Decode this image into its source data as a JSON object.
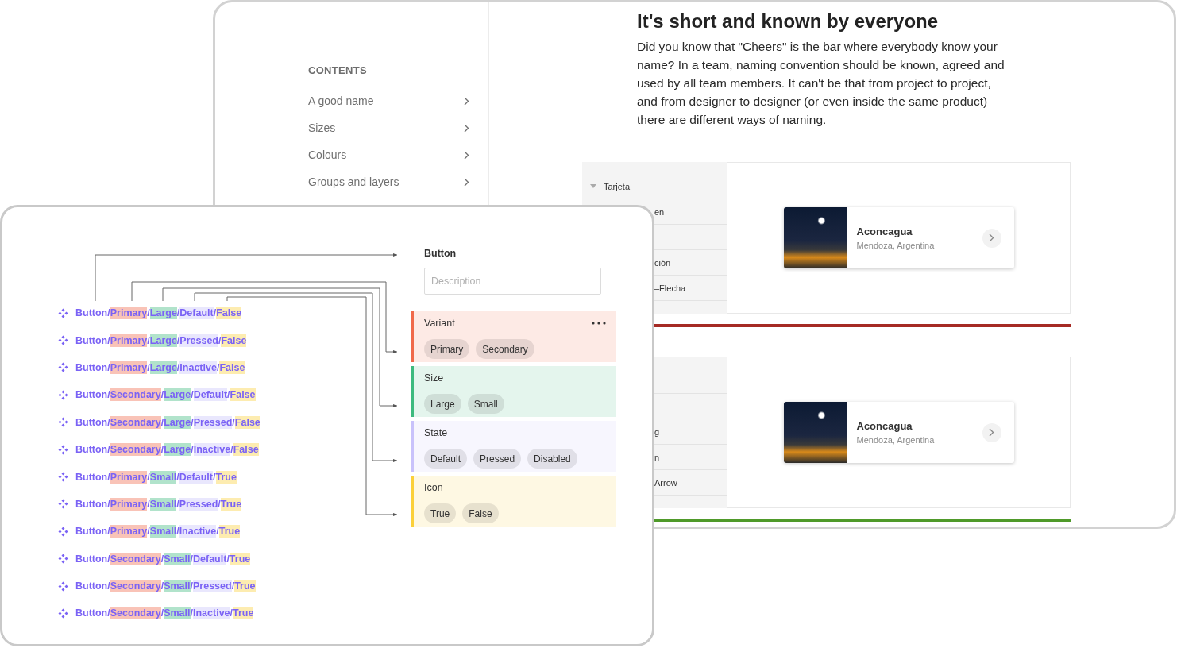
{
  "back_window": {
    "sidebar": {
      "heading": "CONTENTS",
      "items": [
        {
          "label": "A good name"
        },
        {
          "label": "Sizes"
        },
        {
          "label": "Colours"
        },
        {
          "label": "Groups and layers"
        }
      ]
    },
    "article": {
      "title": "It's short and known by everyone",
      "paragraph": "Did you know that \"Cheers\" is the bar where everybody know your name? In a team, naming convention should be known, agreed and used by all team members. It can't be that from project to project, and from designer to designer (or even inside the same product) there are different ways of naming."
    },
    "previews": [
      {
        "color": "#a52a24",
        "layers": [
          {
            "kind": "named",
            "label": "Tarjeta",
            "expanded": true
          },
          {
            "kind": "named",
            "label": "en"
          },
          {
            "kind": "covered"
          },
          {
            "kind": "named",
            "label": "ción"
          },
          {
            "kind": "named",
            "label": "–Flecha"
          }
        ],
        "card": {
          "title": "Aconcagua",
          "subtitle": "Mendoza, Argentina"
        }
      },
      {
        "color": "#4f9a2a",
        "layers": [
          {
            "kind": "covered"
          },
          {
            "kind": "covered"
          },
          {
            "kind": "named",
            "label": "g"
          },
          {
            "kind": "named",
            "label": "n"
          },
          {
            "kind": "named",
            "label": "Arrow"
          }
        ],
        "card": {
          "title": "Aconcagua",
          "subtitle": "Mendoza, Argentina"
        }
      }
    ]
  },
  "front_window": {
    "components": [
      {
        "name": "Button/Primary/Large/Default/False"
      },
      {
        "name": "Button/Primary/Large/Pressed/False"
      },
      {
        "name": "Button/Primary/Large/Inactive/False"
      },
      {
        "name": "Button/Secondary/Large/Default/False"
      },
      {
        "name": "Button/Secondary/Large/Pressed/False"
      },
      {
        "name": "Button/Secondary/Large/Inactive/False"
      },
      {
        "name": "Button/Primary/Small/Default/True"
      },
      {
        "name": "Button/Primary/Small/Pressed/True"
      },
      {
        "name": "Button/Primary/Small/Inactive/True"
      },
      {
        "name": "Button/Secondary/Small/Default/True"
      },
      {
        "name": "Button/Secondary/Small/Pressed/True"
      },
      {
        "name": "Button/Secondary/Small/Inactive/True"
      }
    ],
    "panel": {
      "title": "Button",
      "description": {
        "placeholder": "Description"
      },
      "properties": [
        {
          "name": "Variant",
          "color": "#f0694a",
          "values": [
            "Primary",
            "Secondary"
          ]
        },
        {
          "name": "Size",
          "color": "#3dba7e",
          "values": [
            "Large",
            "Small"
          ]
        },
        {
          "name": "State",
          "color": "#c9c2fb",
          "values": [
            "Default",
            "Pressed",
            "Disabled"
          ]
        },
        {
          "name": "Icon",
          "color": "#fbd03a",
          "values": [
            "True",
            "False"
          ]
        }
      ]
    }
  }
}
